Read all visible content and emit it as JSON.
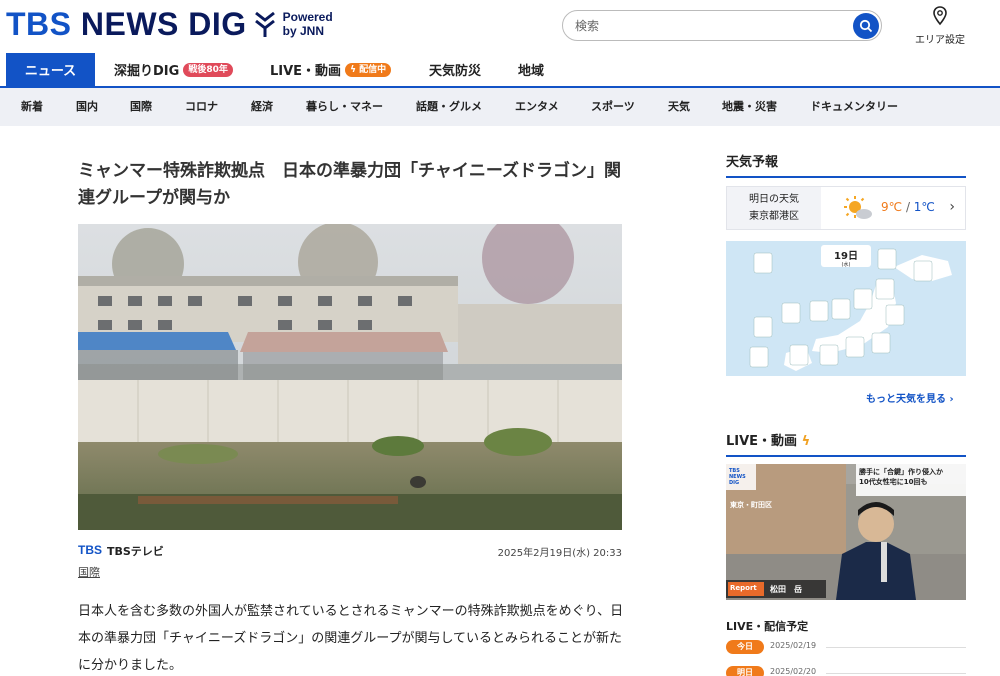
{
  "header": {
    "logo_tbs": "TBS",
    "logo_rest": " NEWS DIG",
    "powered_line1": "Powered",
    "powered_line2": "by JNN",
    "search_placeholder": "検索",
    "area_label": "エリア設定"
  },
  "main_nav": [
    {
      "label": "ニュース",
      "active": true
    },
    {
      "label": "深掘りDIG",
      "badge": "戦後80年"
    },
    {
      "label": "LIVE・動画",
      "badge": "配信中"
    },
    {
      "label": "天気防災"
    },
    {
      "label": "地域"
    }
  ],
  "sub_nav": [
    "新着",
    "国内",
    "国際",
    "コロナ",
    "経済",
    "暮らし・マネー",
    "話題・グルメ",
    "エンタメ",
    "スポーツ",
    "天気",
    "地震・災害",
    "ドキュメンタリー"
  ],
  "article": {
    "title": "ミャンマー特殊詐欺拠点　日本の準暴力団「チャイニーズドラゴン」関連グループが関与か",
    "source_logo": "TBS",
    "source_name": "TBSテレビ",
    "date": "2025年2月19日(水) 20:33",
    "category": "国際",
    "body": "日本人を含む多数の外国人が監禁されているとされるミャンマーの特殊詐欺拠点をめぐり、日本の準暴力団「チャイニーズドラゴン」の関連グループが関与しているとみられることが新たに分かりました。"
  },
  "sidebar": {
    "weather_heading": "天気予報",
    "weather_day": "明日の天気",
    "weather_place": "東京都港区",
    "temp_high": "9℃",
    "temp_sep": " / ",
    "temp_low": "1℃",
    "map_date": "19日",
    "map_weekday": "(水)",
    "more_weather": "もっと天気を見る",
    "live_heading": "LIVE・動画",
    "video": {
      "logo": "TBS NEWS DIG",
      "caption_line1": "勝手に「合鍵」作り侵入か",
      "caption_line2": "10代女性宅に10回も",
      "station": "東京・町田区",
      "reporter_tag": "Report",
      "reporter_name": "松田　岳"
    },
    "schedule_heading": "LIVE・配信予定",
    "schedule": [
      {
        "label": "今日",
        "date": "2025/02/19"
      },
      {
        "label": "明日",
        "date": "2025/02/20"
      }
    ]
  }
}
